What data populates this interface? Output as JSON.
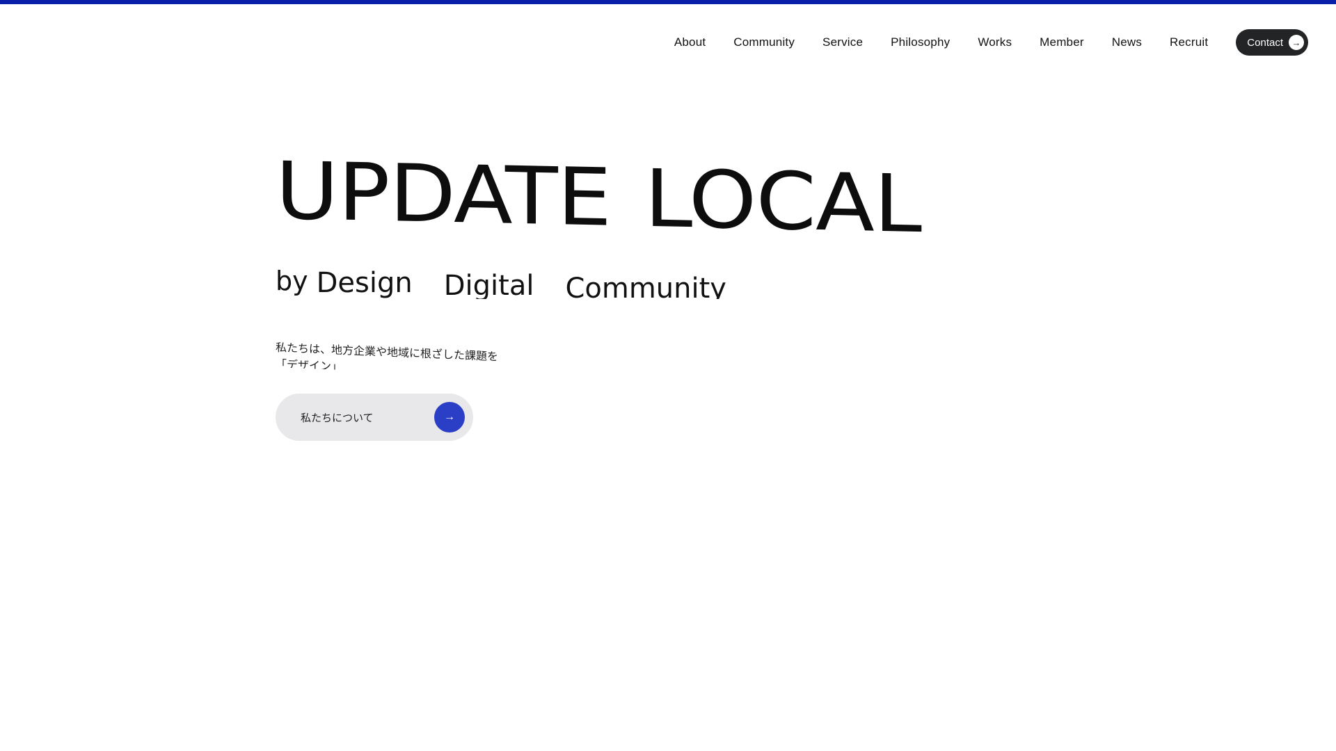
{
  "colors": {
    "accent_bar": "#0a1fa8",
    "contact_bg": "#222426",
    "about_button_bg": "#e8e8ea",
    "about_icon_bg": "#2a3fc6"
  },
  "nav": {
    "items": [
      {
        "label": "About"
      },
      {
        "label": "Community"
      },
      {
        "label": "Service"
      },
      {
        "label": "Philosophy"
      },
      {
        "label": "Works"
      },
      {
        "label": "Member"
      },
      {
        "label": "News"
      },
      {
        "label": "Recruit"
      }
    ],
    "contact": {
      "label": "Contact",
      "icon": "arrow-right-icon"
    }
  },
  "hero": {
    "title_word_1": "UPDATE",
    "title_word_2": "LOCAL",
    "by": "by",
    "taglines": [
      "Design",
      "Digital",
      "Community"
    ],
    "lead_line_1": "私たちは、地方企業や地域に根ざした課題を",
    "lead_line_2": "「デザイン」"
  },
  "about_button": {
    "label": "私たちについて",
    "icon": "arrow-right-icon"
  }
}
